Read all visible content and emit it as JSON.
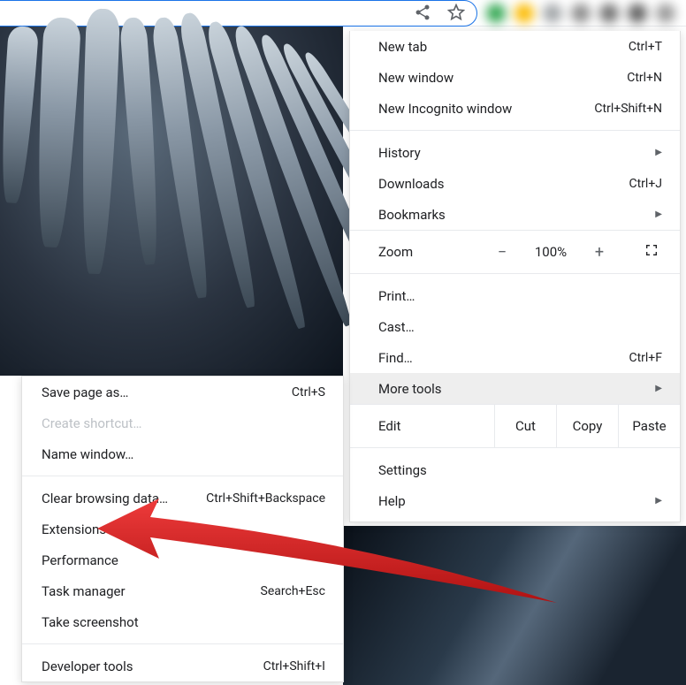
{
  "omnibox_icons": [
    "share-icon",
    "star-icon"
  ],
  "main_menu": {
    "group1": [
      {
        "label": "New tab",
        "shortcut": "Ctrl+T"
      },
      {
        "label": "New window",
        "shortcut": "Ctrl+N"
      },
      {
        "label": "New Incognito window",
        "shortcut": "Ctrl+Shift+N"
      }
    ],
    "group2": [
      {
        "label": "History",
        "arrow": true
      },
      {
        "label": "Downloads",
        "shortcut": "Ctrl+J"
      },
      {
        "label": "Bookmarks",
        "arrow": true
      }
    ],
    "zoom": {
      "label": "Zoom",
      "minus": "−",
      "value": "100%",
      "plus": "+"
    },
    "group3": [
      {
        "label": "Print…"
      },
      {
        "label": "Cast…"
      },
      {
        "label": "Find…",
        "shortcut": "Ctrl+F"
      },
      {
        "label": "More tools",
        "arrow": true,
        "hover": true
      }
    ],
    "edit": {
      "label": "Edit",
      "cut": "Cut",
      "copy": "Copy",
      "paste": "Paste"
    },
    "group4": [
      {
        "label": "Settings"
      },
      {
        "label": "Help",
        "arrow": true
      }
    ]
  },
  "submenu": {
    "group1": [
      {
        "label": "Save page as…",
        "shortcut": "Ctrl+S"
      },
      {
        "label": "Create shortcut…",
        "disabled": true
      },
      {
        "label": "Name window…"
      }
    ],
    "group2": [
      {
        "label": "Clear browsing data…",
        "shortcut": "Ctrl+Shift+Backspace"
      },
      {
        "label": "Extensions"
      },
      {
        "label": "Performance"
      },
      {
        "label": "Task manager",
        "shortcut": "Search+Esc"
      },
      {
        "label": "Take screenshot"
      }
    ],
    "group3": [
      {
        "label": "Developer tools",
        "shortcut": "Ctrl+Shift+I"
      }
    ]
  },
  "arrow_color": "#d81e1e"
}
